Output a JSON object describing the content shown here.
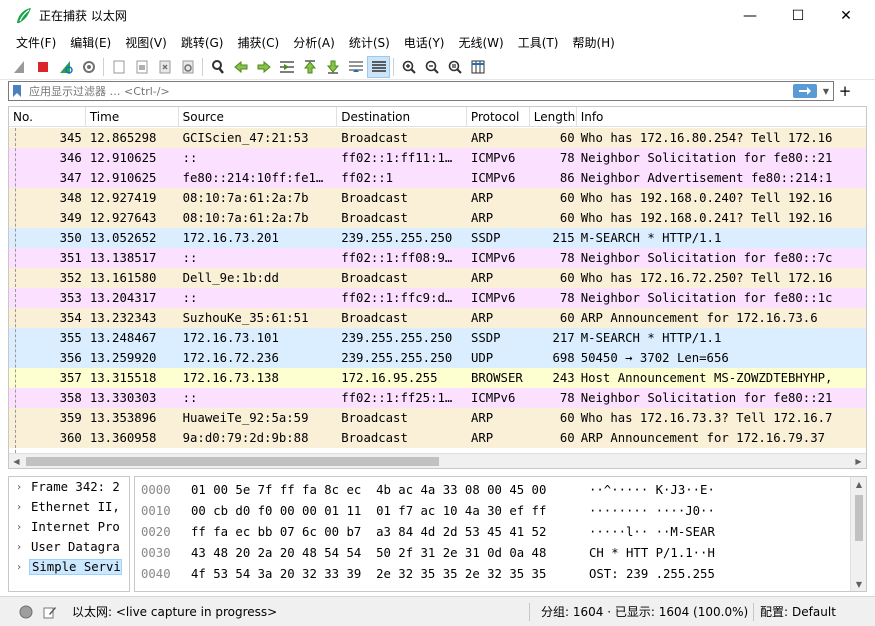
{
  "window": {
    "title": "正在捕获 以太网",
    "min_label": "—",
    "max_label": "☐",
    "close_label": "✕"
  },
  "menu": [
    "文件(F)",
    "编辑(E)",
    "视图(V)",
    "跳转(G)",
    "捕获(C)",
    "分析(A)",
    "统计(S)",
    "电话(Y)",
    "无线(W)",
    "工具(T)",
    "帮助(H)"
  ],
  "filter": {
    "placeholder": "应用显示过滤器 … <Ctrl-/>",
    "add_label": "+"
  },
  "packet_list": {
    "columns": [
      "No.",
      "Time",
      "Source",
      "Destination",
      "Protocol",
      "Length",
      "Info"
    ],
    "rows": [
      {
        "no": "345",
        "time": "12.865298",
        "src": "GCIScien_47:21:53",
        "dst": "Broadcast",
        "proto": "ARP",
        "len": "60",
        "info": "Who has 172.16.80.254? Tell 172.16",
        "color": "#faf0d7"
      },
      {
        "no": "346",
        "time": "12.910625",
        "src": "::",
        "dst": "ff02::1:ff11:1…",
        "proto": "ICMPv6",
        "len": "78",
        "info": "Neighbor Solicitation for fe80::21",
        "color": "#fce0ff"
      },
      {
        "no": "347",
        "time": "12.910625",
        "src": "fe80::214:10ff:fe1…",
        "dst": "ff02::1",
        "proto": "ICMPv6",
        "len": "86",
        "info": "Neighbor Advertisement fe80::214:1",
        "color": "#fce0ff"
      },
      {
        "no": "348",
        "time": "12.927419",
        "src": "08:10:7a:61:2a:7b",
        "dst": "Broadcast",
        "proto": "ARP",
        "len": "60",
        "info": "Who has 192.168.0.240? Tell 192.16",
        "color": "#faf0d7"
      },
      {
        "no": "349",
        "time": "12.927643",
        "src": "08:10:7a:61:2a:7b",
        "dst": "Broadcast",
        "proto": "ARP",
        "len": "60",
        "info": "Who has 192.168.0.241? Tell 192.16",
        "color": "#faf0d7"
      },
      {
        "no": "350",
        "time": "13.052652",
        "src": "172.16.73.201",
        "dst": "239.255.255.250",
        "proto": "SSDP",
        "len": "215",
        "info": "M-SEARCH * HTTP/1.1",
        "color": "#daeeff"
      },
      {
        "no": "351",
        "time": "13.138517",
        "src": "::",
        "dst": "ff02::1:ff08:9…",
        "proto": "ICMPv6",
        "len": "78",
        "info": "Neighbor Solicitation for fe80::7c",
        "color": "#fce0ff"
      },
      {
        "no": "352",
        "time": "13.161580",
        "src": "Dell_9e:1b:dd",
        "dst": "Broadcast",
        "proto": "ARP",
        "len": "60",
        "info": "Who has 172.16.72.250? Tell 172.16",
        "color": "#faf0d7"
      },
      {
        "no": "353",
        "time": "13.204317",
        "src": "::",
        "dst": "ff02::1:ffc9:d…",
        "proto": "ICMPv6",
        "len": "78",
        "info": "Neighbor Solicitation for fe80::1c",
        "color": "#fce0ff"
      },
      {
        "no": "354",
        "time": "13.232343",
        "src": "SuzhouKe_35:61:51",
        "dst": "Broadcast",
        "proto": "ARP",
        "len": "60",
        "info": "ARP Announcement for 172.16.73.6",
        "color": "#faf0d7"
      },
      {
        "no": "355",
        "time": "13.248467",
        "src": "172.16.73.101",
        "dst": "239.255.255.250",
        "proto": "SSDP",
        "len": "217",
        "info": "M-SEARCH * HTTP/1.1",
        "color": "#daeeff"
      },
      {
        "no": "356",
        "time": "13.259920",
        "src": "172.16.72.236",
        "dst": "239.255.255.250",
        "proto": "UDP",
        "len": "698",
        "info": "50450 → 3702 Len=656",
        "color": "#daeeff"
      },
      {
        "no": "357",
        "time": "13.315518",
        "src": "172.16.73.138",
        "dst": "172.16.95.255",
        "proto": "BROWSER",
        "len": "243",
        "info": "Host Announcement MS-ZOWZDTEBHYHP,",
        "color": "#feffd0"
      },
      {
        "no": "358",
        "time": "13.330303",
        "src": "::",
        "dst": "ff02::1:ff25:1…",
        "proto": "ICMPv6",
        "len": "78",
        "info": "Neighbor Solicitation for fe80::21",
        "color": "#fce0ff"
      },
      {
        "no": "359",
        "time": "13.353896",
        "src": "HuaweiTe_92:5a:59",
        "dst": "Broadcast",
        "proto": "ARP",
        "len": "60",
        "info": "Who has 172.16.73.3? Tell 172.16.7",
        "color": "#faf0d7"
      },
      {
        "no": "360",
        "time": "13.360958",
        "src": "9a:d0:79:2d:9b:88",
        "dst": "Broadcast",
        "proto": "ARP",
        "len": "60",
        "info": "ARP Announcement for 172.16.79.37",
        "color": "#faf0d7"
      }
    ]
  },
  "details": [
    {
      "label": "Frame 342: 2",
      "selected": false
    },
    {
      "label": "Ethernet II,",
      "selected": false
    },
    {
      "label": "Internet Pro",
      "selected": false
    },
    {
      "label": "User Datagra",
      "selected": false
    },
    {
      "label": "Simple Servi",
      "selected": true
    }
  ],
  "bytes": [
    {
      "offset": "0000",
      "hex": "01 00 5e 7f ff fa 8c ec  4b ac 4a 33 08 00 45 00",
      "ascii": "··^····· K·J3··E·"
    },
    {
      "offset": "0010",
      "hex": "00 cb d0 f0 00 00 01 11  01 f7 ac 10 4a 30 ef ff",
      "ascii": "········ ····J0··"
    },
    {
      "offset": "0020",
      "hex": "ff fa ec bb 07 6c 00 b7  a3 84 4d 2d 53 45 41 52",
      "ascii": "·····l·· ··M-SEAR"
    },
    {
      "offset": "0030",
      "hex": "43 48 20 2a 20 48 54 54  50 2f 31 2e 31 0d 0a 48",
      "ascii": "CH * HTT P/1.1··H"
    },
    {
      "offset": "0040",
      "hex": "4f 53 54 3a 20 32 33 39  2e 32 35 35 2e 32 35 35",
      "ascii": "OST: 239 .255.255"
    }
  ],
  "status": {
    "interface_text": "以太网: <live capture in progress>",
    "packets_text": "分组: 1604 · 已显示: 1604 (100.0%)",
    "profile_prefix": "配置:",
    "profile_text": "Default"
  },
  "colors": {
    "arp": "#faf0d7",
    "icmpv6": "#fce0ff",
    "udp": "#daeeff",
    "browser": "#feffd0",
    "accent": "#5b9bd5"
  }
}
